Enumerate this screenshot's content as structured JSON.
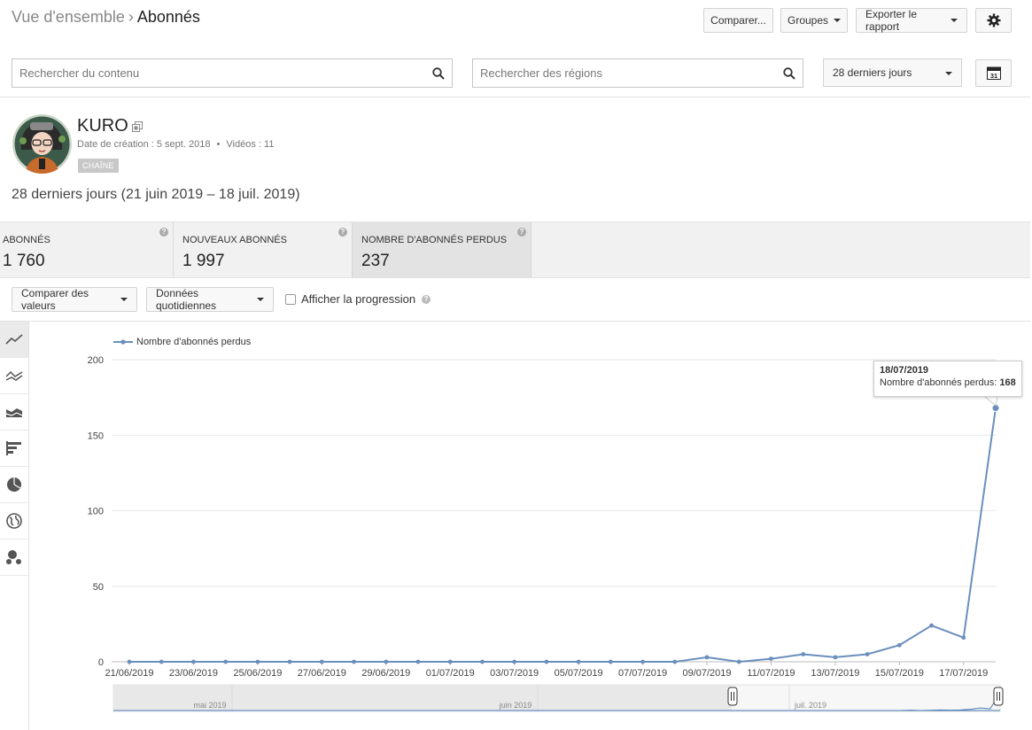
{
  "breadcrumb": {
    "parent": "Vue d'ensemble",
    "separator": "›",
    "current": "Abonnés"
  },
  "toolbar": {
    "compare_label": "Comparer...",
    "groups_label": "Groupes",
    "export_label": "Exporter le rapport",
    "settings_icon": "gear-icon"
  },
  "search": {
    "content_placeholder": "Rechercher du contenu",
    "regions_placeholder": "Rechercher des régions"
  },
  "date_range": {
    "selected": "28 derniers jours",
    "calendar_day": "31"
  },
  "channel": {
    "name": "KURO",
    "created": "Date de création : 5 sept. 2018",
    "separator": "•",
    "videos": "Vidéos : 11",
    "badge": "CHAÎNE"
  },
  "period_text": "28 derniers jours (21 juin 2019 – 18 juil. 2019)",
  "metrics": [
    {
      "label": "ABONNÉS",
      "value": "1 760"
    },
    {
      "label": "NOUVEAUX ABONNÉS",
      "value": "1 997"
    },
    {
      "label": "NOMBRE D'ABONNÉS PERDUS",
      "value": "237"
    }
  ],
  "help_glyph": "?",
  "controls": {
    "compare_values": "Comparer des valeurs",
    "granularity": "Données quotidiennes",
    "show_progress": "Afficher la progression"
  },
  "sidebar_tools": [
    "line-chart-icon",
    "multi-line-icon",
    "stacked-area-icon",
    "bar-chart-icon",
    "pie-chart-icon",
    "globe-icon",
    "bubble-chart-icon"
  ],
  "colors": {
    "series": "#6a8fbd",
    "accent_line": "#4f7cb8"
  },
  "tooltip": {
    "date": "18/07/2019",
    "label": "Nombre d'abonnés perdus:",
    "value": "168"
  },
  "chart_data": {
    "type": "line",
    "legend": [
      "Nombre d'abonnés perdus"
    ],
    "x_tick_labels": [
      "21/06/2019",
      "23/06/2019",
      "25/06/2019",
      "27/06/2019",
      "29/06/2019",
      "01/07/2019",
      "03/07/2019",
      "05/07/2019",
      "07/07/2019",
      "09/07/2019",
      "11/07/2019",
      "13/07/2019",
      "15/07/2019",
      "17/07/2019"
    ],
    "x": [
      "21/06/2019",
      "22/06/2019",
      "23/06/2019",
      "24/06/2019",
      "25/06/2019",
      "26/06/2019",
      "27/06/2019",
      "28/06/2019",
      "29/06/2019",
      "30/06/2019",
      "01/07/2019",
      "02/07/2019",
      "03/07/2019",
      "04/07/2019",
      "05/07/2019",
      "06/07/2019",
      "07/07/2019",
      "08/07/2019",
      "09/07/2019",
      "10/07/2019",
      "11/07/2019",
      "12/07/2019",
      "13/07/2019",
      "14/07/2019",
      "15/07/2019",
      "16/07/2019",
      "17/07/2019",
      "18/07/2019"
    ],
    "series": [
      {
        "name": "Nombre d'abonnés perdus",
        "values": [
          0,
          0,
          0,
          0,
          0,
          0,
          0,
          0,
          0,
          0,
          0,
          0,
          0,
          0,
          0,
          0,
          0,
          0,
          3,
          0,
          2,
          5,
          3,
          5,
          11,
          24,
          16,
          168
        ]
      }
    ],
    "y_ticks": [
      0,
      50,
      100,
      150,
      200
    ],
    "ylim": [
      0,
      200
    ],
    "grid": true,
    "legend_position": "top-left",
    "navigator_labels": [
      "mai 2019",
      "juin 2019",
      "juil. 2019"
    ]
  }
}
